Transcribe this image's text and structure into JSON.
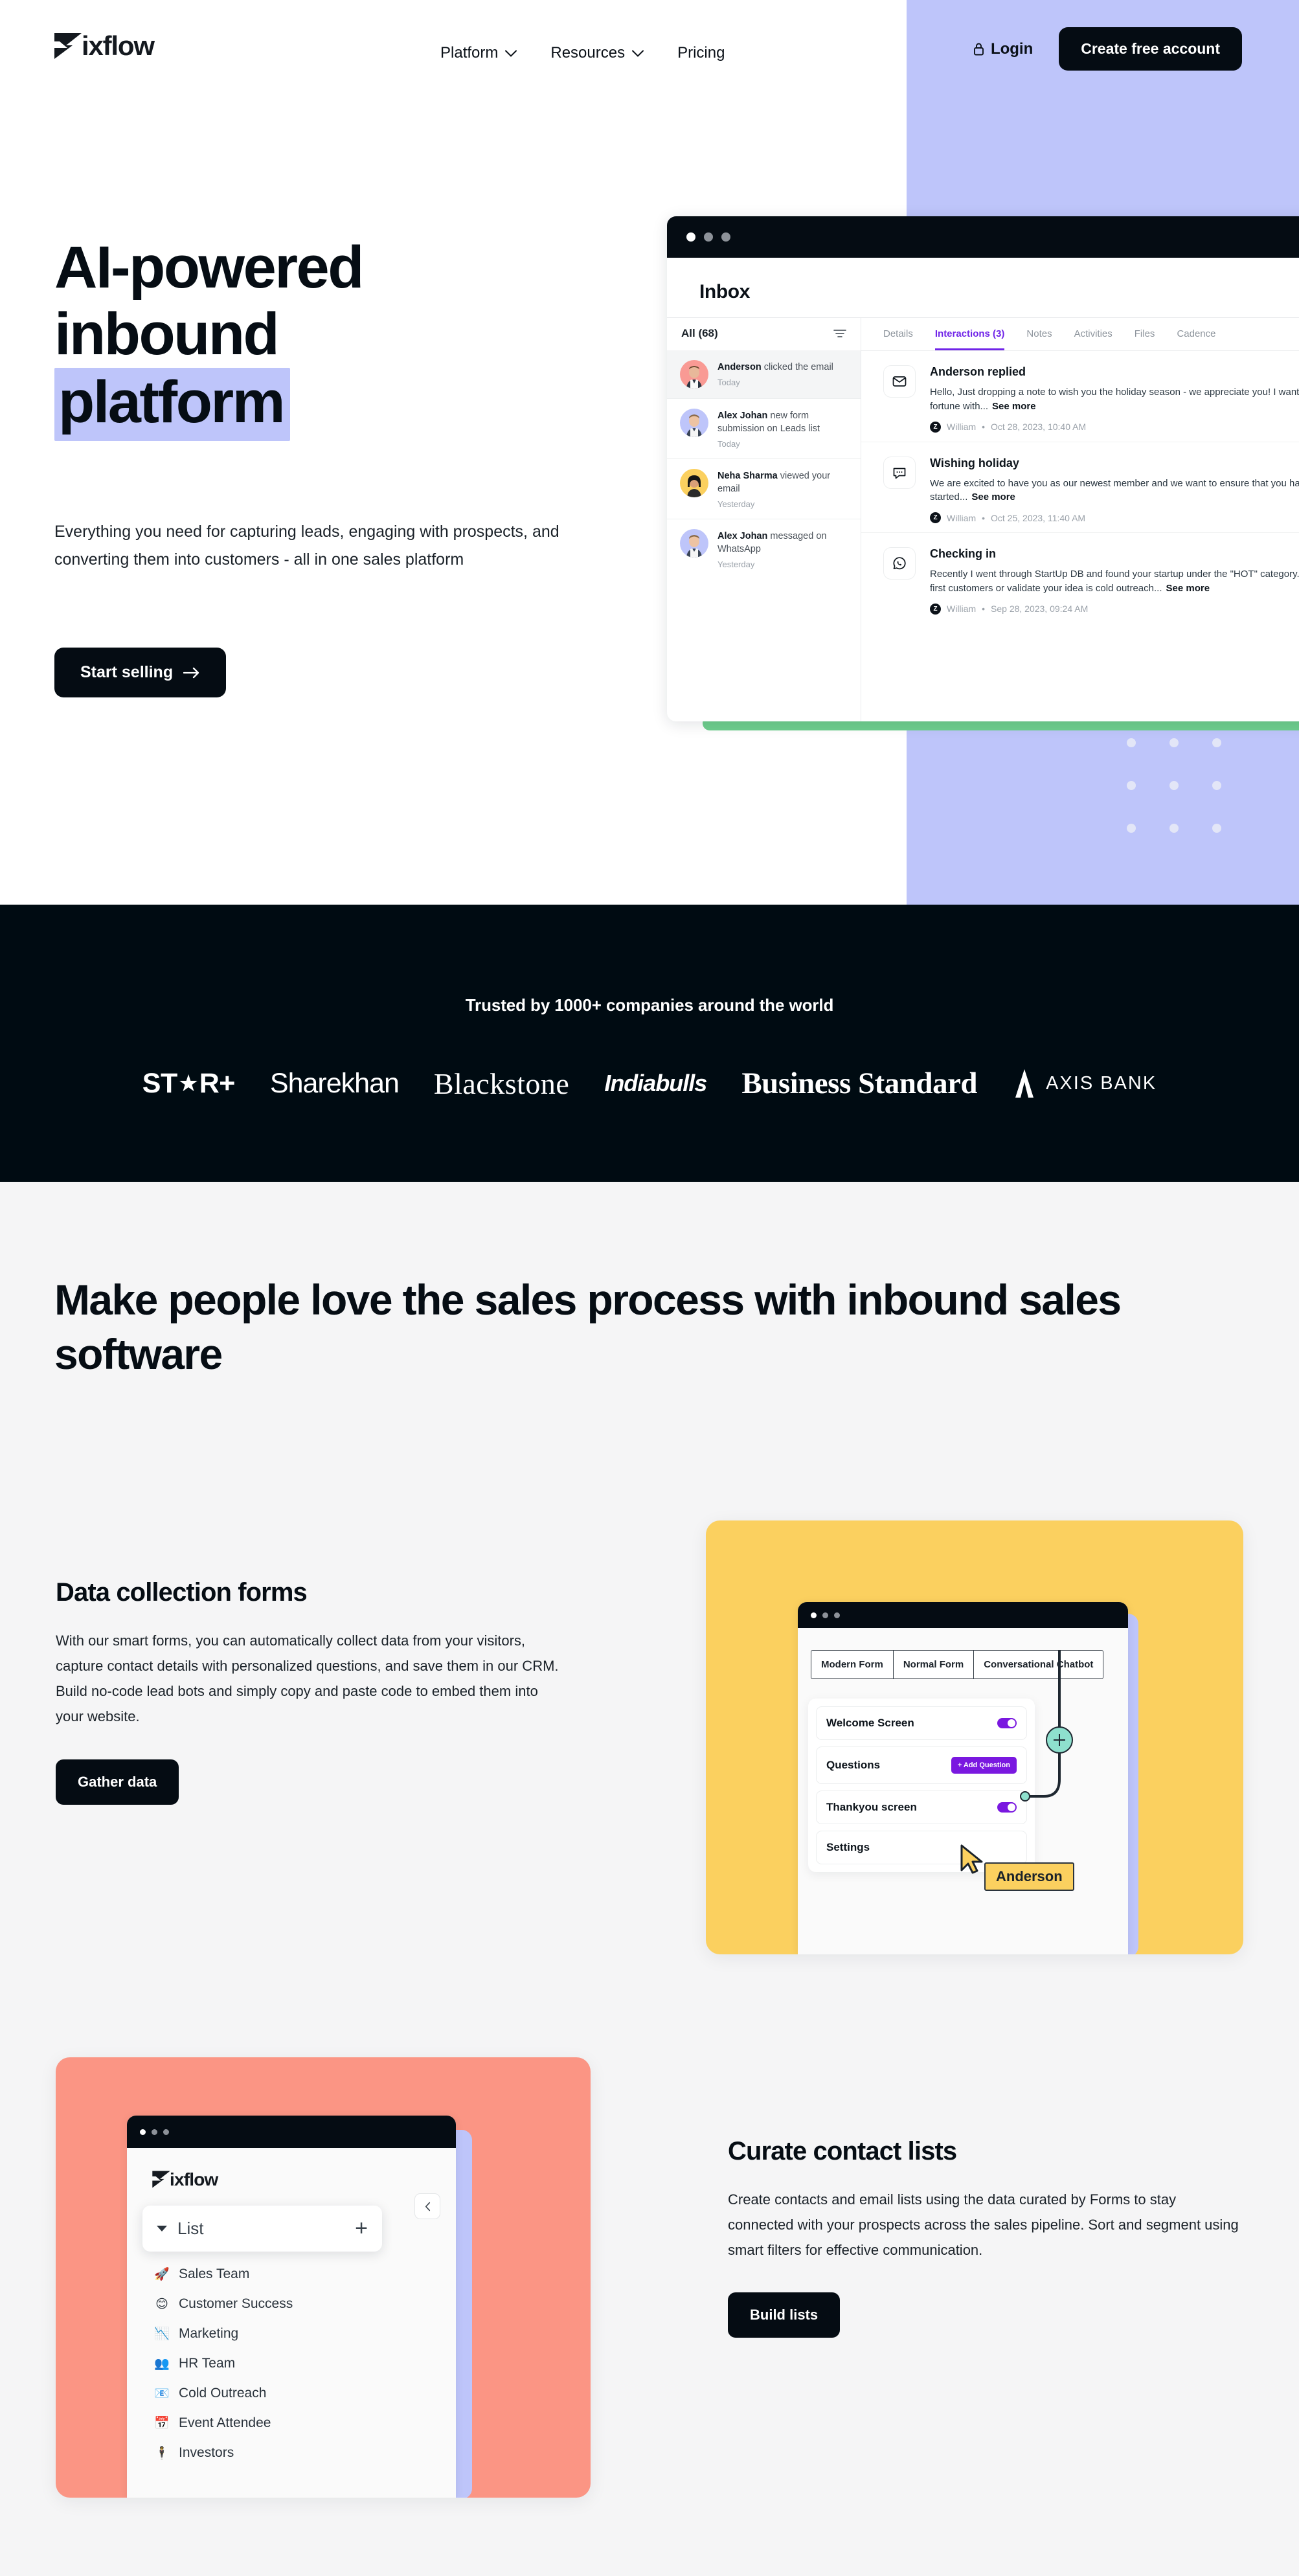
{
  "brand": {
    "name": "Zixflow",
    "logo_word": "ixflow"
  },
  "nav": {
    "links": [
      {
        "label": "Platform",
        "has_dropdown": true
      },
      {
        "label": "Resources",
        "has_dropdown": true
      },
      {
        "label": "Pricing",
        "has_dropdown": false
      }
    ],
    "login_label": "Login",
    "cta_label": "Create free account"
  },
  "hero": {
    "title_line1": "AI-powered",
    "title_line2": "inbound",
    "title_highlight": "platform",
    "subtitle": "Everything you need for capturing leads, engaging with prospects, and converting them into customers - all in one sales platform",
    "cta_label": "Start selling",
    "highlight_color": "#bec5fa",
    "panel_color": "#bec5fa",
    "accent_green": "#6fcf8e"
  },
  "inbox_mock": {
    "window_title": "Inbox",
    "list_header": "All (68)",
    "list_items": [
      {
        "name": "Anderson",
        "action": "clicked the email",
        "time": "Today",
        "avatar_color": "#f99a94",
        "selected": true
      },
      {
        "name": "Alex Johan",
        "action": "new form submission on Leads list",
        "time": "Today",
        "avatar_color": "#bec5fa",
        "selected": false
      },
      {
        "name": "Neha Sharma",
        "action": "viewed your email",
        "time": "Yesterday",
        "avatar_color": "#fbd05f",
        "selected": false
      },
      {
        "name": "Alex Johan",
        "action": "messaged on WhatsApp",
        "time": "Yesterday",
        "avatar_color": "#bec5fa",
        "selected": false
      }
    ],
    "tabs": [
      {
        "label": "Details",
        "active": false
      },
      {
        "label": "Interactions (3)",
        "active": true
      },
      {
        "label": "Notes",
        "active": false
      },
      {
        "label": "Activities",
        "active": false
      },
      {
        "label": "Files",
        "active": false
      },
      {
        "label": "Cadence",
        "active": false
      }
    ],
    "active_tab_color": "#7024e8",
    "interactions": [
      {
        "icon": "mail-icon",
        "title": "Anderson replied",
        "text": "Hello, Just dropping a note to wish you the holiday season - we appreciate you!  I want fortune with...",
        "see_more": "See more",
        "author": "William",
        "timestamp": "Oct 28, 2023, 10:40 AM"
      },
      {
        "icon": "chat-icon",
        "title": "Wishing holiday",
        "text": "We are excited to have you as our newest member and we want to ensure that you have started...",
        "see_more": "See more",
        "author": "William",
        "timestamp": "Oct 25, 2023, 11:40 AM"
      },
      {
        "icon": "whatsapp-icon",
        "title": "Checking in",
        "text": "Recently I went through StartUp DB and found your startup under the \"HOT\" category. attract first customers or validate your idea is cold outreach...",
        "see_more": "See more",
        "author": "William",
        "timestamp": "Sep 28, 2023, 09:24 AM"
      }
    ]
  },
  "trusted": {
    "heading": "Trusted by 1000+ companies around the world",
    "background": "#000b12",
    "logos": [
      {
        "name": "STAR+",
        "style": "star"
      },
      {
        "name": "Sharekhan",
        "style": "sharekhan"
      },
      {
        "name": "Blackstone",
        "style": "blackstone"
      },
      {
        "name": "Indiabulls",
        "style": "indiabulls"
      },
      {
        "name": "Business Standard",
        "style": "business-standard"
      },
      {
        "name": "AXIS BANK",
        "style": "axis"
      }
    ]
  },
  "features": {
    "section_heading": "Make people love the sales process with inbound sales software",
    "background": "#f5f5f6",
    "rows": [
      {
        "title": "Data collection forms",
        "text": "With our smart forms, you can automatically collect data from your visitors, capture contact details with personalized questions, and save them in our CRM. Build no-code lead bots and simply copy and paste code to embed them into your website.",
        "button": "Gather data",
        "card_color": "#fbd05f"
      },
      {
        "title": "Curate contact lists",
        "text": "Create contacts and email lists using the data curated by Forms to stay connected with your prospects across the sales pipeline. Sort and segment using smart filters for effective communication.",
        "button": "Build lists",
        "card_color": "#fb9584"
      }
    ]
  },
  "form_builder_mock": {
    "segments": [
      "Modern Form",
      "Normal Form",
      "Conversational Chatbot"
    ],
    "rows": [
      {
        "label": "Welcome Screen",
        "control": "toggle",
        "toggle_on": true
      },
      {
        "label": "Questions",
        "control": "button",
        "button_label": "+ Add Question"
      },
      {
        "label": "Thankyou screen",
        "control": "toggle",
        "toggle_on": true
      },
      {
        "label": "Settings",
        "control": "none"
      }
    ],
    "cursor_name": "Anderson",
    "toggle_color": "#7a18e0",
    "node_color": "#8ee0cd"
  },
  "lists_mock": {
    "logo_word": "ixflow",
    "dropdown_label": "List",
    "add_icon": "plus-icon",
    "collapse_icon": "chevron-left-icon",
    "items": [
      {
        "emoji": "🚀",
        "label": "Sales Team"
      },
      {
        "emoji": "😊",
        "label": "Customer Success"
      },
      {
        "emoji": "📉",
        "label": "Marketing"
      },
      {
        "emoji": "👥",
        "label": "HR Team"
      },
      {
        "emoji": "📧",
        "label": "Cold Outreach"
      },
      {
        "emoji": "📅",
        "label": "Event Attendee"
      },
      {
        "emoji": "🕴",
        "label": "Investors"
      }
    ]
  }
}
